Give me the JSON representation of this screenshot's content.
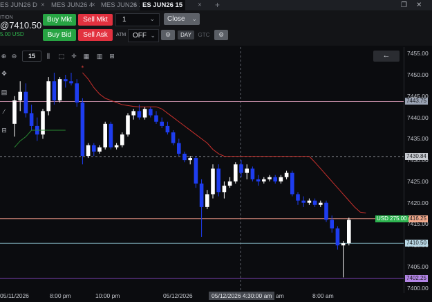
{
  "tabs": [
    {
      "label": "ES JUN26",
      "sub": "D"
    },
    {
      "label": "MES JUN26",
      "sub": "4"
    },
    {
      "label": "MES JUN26",
      "sub": "2"
    },
    {
      "label": "ES JUN26",
      "sub": "15",
      "active": true
    }
  ],
  "account": {
    "position_label": "ITION",
    "price": "@7410.50",
    "pnl": "5.00 USD"
  },
  "order_bar": {
    "buy_mkt": "Buy Mkt",
    "sell_mkt": "Sell Mkt",
    "buy_bid": "Buy Bid",
    "sell_ask": "Sell Ask",
    "quantity": "1",
    "close": "Close",
    "atm_label": "ATM",
    "atm_value": "OFF",
    "tif_day": "DAY",
    "tif_gtc": "GTC"
  },
  "toolbar": {
    "timeframe": "15"
  },
  "price_axis": {
    "ticks": [
      "7455.00",
      "7450.00",
      "7445.00",
      "7440.00",
      "7435.00",
      "7430.00",
      "7425.00",
      "7420.00",
      "7415.00",
      "7410.00",
      "7405.00",
      "7400.00"
    ],
    "levels": {
      "upper_line": "7443.75",
      "dashed_line": "7430.84",
      "position_line": "7416.25",
      "last_price": "7410.50",
      "lower_line": "7402.25"
    },
    "pnl_tag": "USD 275.00"
  },
  "time_axis": {
    "labels": [
      "05/11/2026",
      "8:00 pm",
      "10:00 pm",
      "05/12/2026",
      "am",
      "8:00 am"
    ],
    "cursor": "05/12/2026 4:30:00 am"
  },
  "chart_data": {
    "type": "candlestick",
    "instrument": "ES JUN26",
    "timeframe": "15",
    "ylim": [
      7399.0,
      7456.5
    ],
    "candles": [
      {
        "o": 7438.5,
        "h": 7445.0,
        "l": 7435.5,
        "c": 7444.0
      },
      {
        "o": 7444.0,
        "h": 7448.5,
        "l": 7441.5,
        "c": 7446.0
      },
      {
        "o": 7446.0,
        "h": 7448.0,
        "l": 7440.0,
        "c": 7441.0
      },
      {
        "o": 7441.0,
        "h": 7443.0,
        "l": 7437.0,
        "c": 7438.0
      },
      {
        "o": 7438.0,
        "h": 7440.0,
        "l": 7434.5,
        "c": 7436.0
      },
      {
        "o": 7436.0,
        "h": 7442.0,
        "l": 7435.0,
        "c": 7441.5
      },
      {
        "o": 7441.5,
        "h": 7449.5,
        "l": 7440.5,
        "c": 7448.5
      },
      {
        "o": 7448.5,
        "h": 7450.5,
        "l": 7443.0,
        "c": 7444.0
      },
      {
        "o": 7444.0,
        "h": 7449.5,
        "l": 7443.5,
        "c": 7449.0
      },
      {
        "o": 7449.0,
        "h": 7450.0,
        "l": 7447.0,
        "c": 7448.5
      },
      {
        "o": 7448.5,
        "h": 7450.5,
        "l": 7447.5,
        "c": 7448.0
      },
      {
        "o": 7448.0,
        "h": 7449.0,
        "l": 7442.5,
        "c": 7443.5
      },
      {
        "o": 7443.5,
        "h": 7444.5,
        "l": 7429.0,
        "c": 7431.0
      },
      {
        "o": 7431.0,
        "h": 7434.0,
        "l": 7430.5,
        "c": 7433.5
      },
      {
        "o": 7433.5,
        "h": 7434.0,
        "l": 7431.0,
        "c": 7432.0
      },
      {
        "o": 7432.0,
        "h": 7433.5,
        "l": 7431.5,
        "c": 7433.0
      },
      {
        "o": 7433.0,
        "h": 7439.0,
        "l": 7432.5,
        "c": 7438.5
      },
      {
        "o": 7438.5,
        "h": 7439.0,
        "l": 7432.5,
        "c": 7433.0
      },
      {
        "o": 7433.0,
        "h": 7434.0,
        "l": 7432.5,
        "c": 7433.5
      },
      {
        "o": 7433.5,
        "h": 7436.5,
        "l": 7433.0,
        "c": 7436.0
      },
      {
        "o": 7436.0,
        "h": 7441.0,
        "l": 7435.5,
        "c": 7440.5
      },
      {
        "o": 7440.5,
        "h": 7442.0,
        "l": 7439.5,
        "c": 7441.5
      },
      {
        "o": 7441.5,
        "h": 7443.0,
        "l": 7439.5,
        "c": 7440.0
      },
      {
        "o": 7440.0,
        "h": 7442.5,
        "l": 7439.5,
        "c": 7442.0
      },
      {
        "o": 7442.0,
        "h": 7442.5,
        "l": 7440.0,
        "c": 7440.5
      },
      {
        "o": 7440.5,
        "h": 7441.5,
        "l": 7438.5,
        "c": 7439.0
      },
      {
        "o": 7439.0,
        "h": 7440.0,
        "l": 7437.5,
        "c": 7438.0
      },
      {
        "o": 7438.0,
        "h": 7439.0,
        "l": 7436.0,
        "c": 7436.5
      },
      {
        "o": 7436.5,
        "h": 7437.0,
        "l": 7433.5,
        "c": 7434.0
      },
      {
        "o": 7434.0,
        "h": 7435.0,
        "l": 7431.0,
        "c": 7431.5
      },
      {
        "o": 7431.5,
        "h": 7432.0,
        "l": 7429.5,
        "c": 7430.0
      },
      {
        "o": 7430.0,
        "h": 7431.0,
        "l": 7429.0,
        "c": 7430.5
      },
      {
        "o": 7430.5,
        "h": 7431.0,
        "l": 7423.5,
        "c": 7424.5
      },
      {
        "o": 7424.5,
        "h": 7425.5,
        "l": 7412.0,
        "c": 7419.0
      },
      {
        "o": 7419.0,
        "h": 7423.0,
        "l": 7418.5,
        "c": 7422.0
      },
      {
        "o": 7422.0,
        "h": 7429.0,
        "l": 7421.0,
        "c": 7428.0
      },
      {
        "o": 7428.0,
        "h": 7429.0,
        "l": 7421.5,
        "c": 7422.5
      },
      {
        "o": 7422.5,
        "h": 7425.0,
        "l": 7421.0,
        "c": 7424.0
      },
      {
        "o": 7424.0,
        "h": 7426.0,
        "l": 7423.5,
        "c": 7425.0
      },
      {
        "o": 7425.0,
        "h": 7429.5,
        "l": 7424.5,
        "c": 7429.0
      },
      {
        "o": 7429.0,
        "h": 7430.0,
        "l": 7426.0,
        "c": 7427.0
      },
      {
        "o": 7427.0,
        "h": 7429.0,
        "l": 7425.5,
        "c": 7428.0
      },
      {
        "o": 7428.0,
        "h": 7428.5,
        "l": 7425.0,
        "c": 7425.5
      },
      {
        "o": 7425.5,
        "h": 7426.5,
        "l": 7424.0,
        "c": 7425.0
      },
      {
        "o": 7425.0,
        "h": 7426.0,
        "l": 7424.5,
        "c": 7425.5
      },
      {
        "o": 7425.5,
        "h": 7426.5,
        "l": 7425.0,
        "c": 7426.0
      },
      {
        "o": 7426.0,
        "h": 7426.5,
        "l": 7424.5,
        "c": 7425.0
      },
      {
        "o": 7425.0,
        "h": 7426.5,
        "l": 7424.5,
        "c": 7426.0
      },
      {
        "o": 7426.0,
        "h": 7427.5,
        "l": 7425.5,
        "c": 7427.0
      },
      {
        "o": 7427.0,
        "h": 7427.5,
        "l": 7421.5,
        "c": 7422.0
      },
      {
        "o": 7422.0,
        "h": 7422.5,
        "l": 7419.5,
        "c": 7420.5
      },
      {
        "o": 7420.5,
        "h": 7421.5,
        "l": 7419.0,
        "c": 7420.0
      },
      {
        "o": 7420.0,
        "h": 7421.0,
        "l": 7419.5,
        "c": 7420.5
      },
      {
        "o": 7420.5,
        "h": 7421.0,
        "l": 7419.0,
        "c": 7419.5
      },
      {
        "o": 7419.5,
        "h": 7420.5,
        "l": 7419.0,
        "c": 7420.0
      },
      {
        "o": 7420.0,
        "h": 7420.5,
        "l": 7415.5,
        "c": 7416.0
      },
      {
        "o": 7416.0,
        "h": 7417.0,
        "l": 7413.0,
        "c": 7414.0
      },
      {
        "o": 7414.0,
        "h": 7414.5,
        "l": 7409.0,
        "c": 7410.0
      },
      {
        "o": 7410.0,
        "h": 7411.0,
        "l": 7402.5,
        "c": 7410.5
      },
      {
        "o": 7410.5,
        "h": 7416.5,
        "l": 7410.0,
        "c": 7416.0
      }
    ],
    "stop_line_upper": [
      7450.5,
      7449.0,
      7447.0,
      7445.5,
      7444.5,
      7444.0,
      7443.5,
      7443.0,
      7442.8,
      7442.6,
      7442.5,
      7442.5,
      7442.5,
      7442.5,
      7442.0,
      7441.0,
      7440.0,
      7439.0,
      7438.0,
      7437.0,
      7436.0,
      7435.0,
      7434.0,
      7432.5,
      7431.5,
      7430.9,
      7430.9,
      7430.9,
      7430.9,
      7430.9,
      7430.9,
      7430.9,
      7430.9,
      7430.9,
      7430.9,
      7430.9,
      7430.9,
      7430.9,
      7430.9,
      7430.9,
      7430.9,
      7429.5,
      7428.0,
      7426.5,
      7425.0,
      7423.5,
      7422.0,
      7420.5,
      7419.0,
      7417.8,
      7417.6
    ],
    "stop_line_lower": [
      7433.0,
      7434.5,
      7435.5,
      7437.0,
      7437.0,
      7437.0,
      7437.0,
      7437.0,
      7437.0,
      7437.0
    ],
    "horizontal_lines": [
      7443.75,
      7430.84,
      7416.25,
      7410.5,
      7402.25
    ]
  },
  "colors": {
    "bull": "#ffffff",
    "bear": "#1e3df0",
    "stop_upper": "#c9302c",
    "stop_lower": "#2a8a32",
    "line_upper": "#b8849c",
    "line_position": "#d78a7c",
    "line_last": "#7aa6b2",
    "line_lower": "#7a3fb0",
    "tag_upper": "#9ba4b4",
    "tag_position": "#f2a98c",
    "tag_last": "#b9d9e6",
    "tag_lower": "#b385e6",
    "tag_pnl": "#2db34f"
  }
}
